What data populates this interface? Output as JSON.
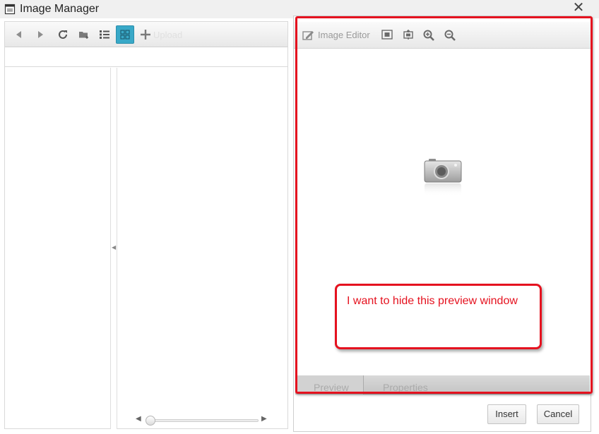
{
  "window": {
    "title": "Image Manager",
    "close_glyph": "✕"
  },
  "toolbar": {
    "buttons": [
      {
        "name": "back-icon"
      },
      {
        "name": "forward-icon"
      },
      {
        "name": "refresh-icon"
      },
      {
        "name": "new-folder-icon"
      },
      {
        "name": "list-view-icon"
      },
      {
        "name": "thumbnail-view-icon",
        "active": true
      },
      {
        "name": "add-icon"
      }
    ],
    "upload_label": "Upload"
  },
  "preview": {
    "editor_label": "Image Editor",
    "tools": [
      "best-fit-icon",
      "actual-size-icon",
      "zoom-in-icon",
      "zoom-out-icon"
    ],
    "placeholder_icon": "camera-icon",
    "tabs": [
      "Preview",
      "Properties"
    ],
    "active_tab": "Preview"
  },
  "footer": {
    "insert_label": "Insert",
    "cancel_label": "Cancel"
  },
  "annotation": {
    "text": "I want to hide this preview window",
    "color": "#e5121f"
  },
  "colors": {
    "accent": "#39a9c8",
    "annotation_red": "#e5121f"
  }
}
